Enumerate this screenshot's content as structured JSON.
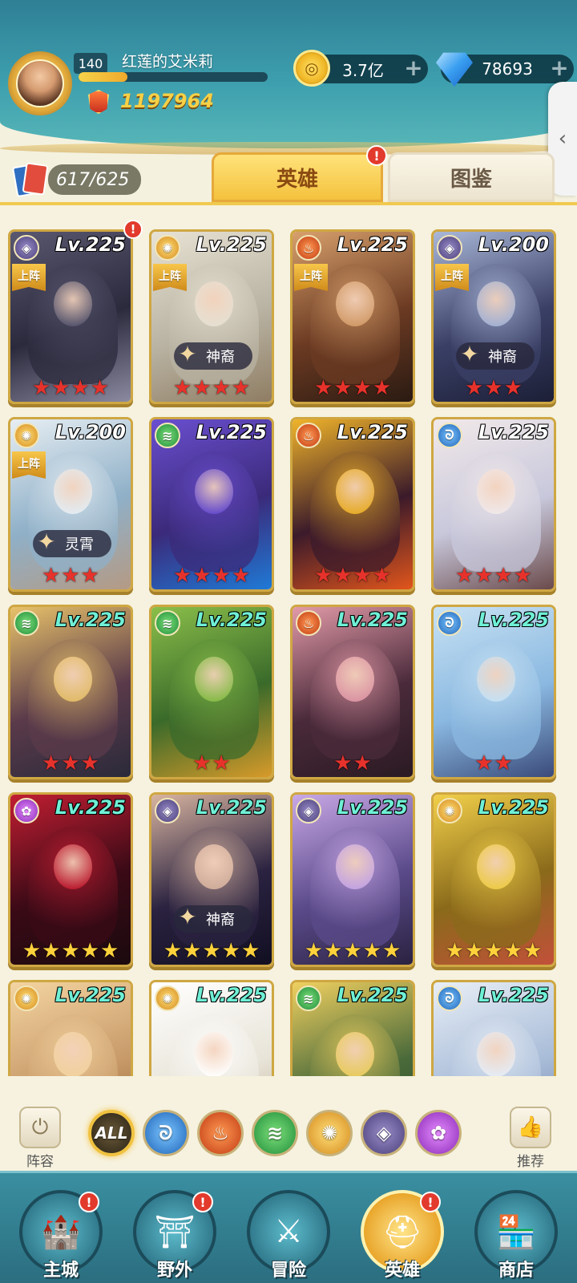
{
  "player": {
    "level": "140",
    "name": "红莲的艾米莉",
    "exp_fraction": 0.26,
    "power": "1197964",
    "avatar_icon": "player-avatar"
  },
  "currencies": {
    "gold": "3.7亿",
    "gold_icon_glyph": "◎",
    "diamonds": "78693",
    "plus": "+"
  },
  "side_tab_arrow": "‹",
  "collection": {
    "count": "617/625"
  },
  "tabs": {
    "heroes": "英雄",
    "codex": "图鉴",
    "badge": "!"
  },
  "element_glyphs": {
    "dark": "◈",
    "light": "✺",
    "fire": "♨",
    "wind": "≋",
    "water": "ᘐ",
    "arcane": "✿"
  },
  "labels": {
    "deployed": "上阵",
    "star": "★",
    "badge": "!"
  },
  "heroes": [
    {
      "element": "dark",
      "level": "Lv.225",
      "deployed": true,
      "tag": "",
      "stars": 4,
      "star_color": "red",
      "badge": true,
      "level_color": "white",
      "palette": [
        "#2b2a3d",
        "#5a5870",
        "#8b8aa0"
      ]
    },
    {
      "element": "light",
      "level": "Lv.225",
      "deployed": true,
      "tag": "神裔",
      "stars": 4,
      "star_color": "red",
      "badge": false,
      "level_color": "white",
      "palette": [
        "#b9b3a3",
        "#e8e2d4",
        "#8f7d63"
      ]
    },
    {
      "element": "fire",
      "level": "Lv.225",
      "deployed": true,
      "tag": "",
      "stars": 4,
      "star_color": "red",
      "badge": false,
      "level_color": "white",
      "palette": [
        "#6b3a22",
        "#d7a06c",
        "#2a1a12"
      ]
    },
    {
      "element": "dark",
      "level": "Lv.200",
      "deployed": true,
      "tag": "神裔",
      "stars": 3,
      "star_color": "red",
      "badge": false,
      "level_color": "white",
      "palette": [
        "#3a3f66",
        "#a9b7d8",
        "#1c1f36"
      ]
    },
    {
      "element": "light",
      "level": "Lv.200",
      "deployed": true,
      "tag": "灵霄",
      "stars": 3,
      "star_color": "red",
      "badge": false,
      "level_color": "white",
      "palette": [
        "#8fb0c8",
        "#e7eef3",
        "#b59a84"
      ]
    },
    {
      "element": "wind",
      "level": "Lv.225",
      "deployed": false,
      "tag": "",
      "stars": 4,
      "star_color": "red",
      "badge": false,
      "level_color": "white",
      "palette": [
        "#3b2a7a",
        "#6a4fd0",
        "#1f7ad6"
      ]
    },
    {
      "element": "fire",
      "level": "Lv.225",
      "deployed": false,
      "tag": "",
      "stars": 4,
      "star_color": "red",
      "badge": false,
      "level_color": "white",
      "palette": [
        "#3b1a2a",
        "#f0b42a",
        "#e2561c"
      ]
    },
    {
      "element": "water",
      "level": "Lv.225",
      "deployed": false,
      "tag": "",
      "stars": 4,
      "star_color": "red",
      "badge": false,
      "level_color": "white",
      "palette": [
        "#c8c8dc",
        "#f2e9e9",
        "#6a4a4a"
      ]
    },
    {
      "element": "wind",
      "level": "Lv.225",
      "deployed": false,
      "tag": "",
      "stars": 3,
      "star_color": "red",
      "badge": false,
      "level_color": "teal",
      "palette": [
        "#5a3a4a",
        "#e8c26a",
        "#2a2a3a"
      ]
    },
    {
      "element": "wind",
      "level": "Lv.225",
      "deployed": false,
      "tag": "",
      "stars": 2,
      "star_color": "red",
      "badge": false,
      "level_color": "teal",
      "palette": [
        "#3a6a2a",
        "#8bbf4a",
        "#d79a2a"
      ]
    },
    {
      "element": "fire",
      "level": "Lv.225",
      "deployed": false,
      "tag": "",
      "stars": 2,
      "star_color": "red",
      "badge": false,
      "level_color": "teal",
      "palette": [
        "#4a2a3a",
        "#e29aa8",
        "#2a1a22"
      ]
    },
    {
      "element": "water",
      "level": "Lv.225",
      "deployed": false,
      "tag": "",
      "stars": 2,
      "star_color": "red",
      "badge": false,
      "level_color": "teal",
      "palette": [
        "#8ab8e0",
        "#c8e2f4",
        "#3a4a7a"
      ]
    },
    {
      "element": "arcane",
      "level": "Lv.225",
      "deployed": false,
      "tag": "",
      "stars": 5,
      "star_color": "gold",
      "badge": false,
      "level_color": "teal",
      "palette": [
        "#3a0a16",
        "#c21e32",
        "#1a0a0e"
      ]
    },
    {
      "element": "dark",
      "level": "Lv.225",
      "deployed": false,
      "tag": "神裔",
      "stars": 5,
      "star_color": "gold",
      "badge": false,
      "level_color": "teal",
      "palette": [
        "#2a2240",
        "#d8b4a0",
        "#120f22"
      ]
    },
    {
      "element": "dark",
      "level": "Lv.225",
      "deployed": false,
      "tag": "",
      "stars": 5,
      "star_color": "gold",
      "badge": false,
      "level_color": "teal",
      "palette": [
        "#5a4a8a",
        "#c9a8e6",
        "#2a2240"
      ]
    },
    {
      "element": "light",
      "level": "Lv.225",
      "deployed": false,
      "tag": "",
      "stars": 5,
      "star_color": "gold",
      "badge": false,
      "level_color": "teal",
      "palette": [
        "#8a6a1a",
        "#f2d04a",
        "#c2503a"
      ]
    },
    {
      "element": "light",
      "level": "Lv.225",
      "deployed": false,
      "tag": "",
      "stars": 0,
      "star_color": "gold",
      "badge": false,
      "level_color": "teal",
      "palette": [
        "#c89a6a",
        "#f3d4a0",
        "#8a5a2a"
      ]
    },
    {
      "element": "light",
      "level": "Lv.225",
      "deployed": false,
      "tag": "",
      "stars": 0,
      "star_color": "gold",
      "badge": false,
      "level_color": "teal",
      "palette": [
        "#e8e4d8",
        "#ffffff",
        "#b7a28a"
      ]
    },
    {
      "element": "wind",
      "level": "Lv.225",
      "deployed": false,
      "tag": "",
      "stars": 0,
      "star_color": "gold",
      "badge": false,
      "level_color": "teal",
      "palette": [
        "#4a6a3a",
        "#f0d060",
        "#2a4a2a"
      ]
    },
    {
      "element": "water",
      "level": "Lv.225",
      "deployed": false,
      "tag": "",
      "stars": 0,
      "star_color": "gold",
      "badge": false,
      "level_color": "teal",
      "palette": [
        "#a8bcd8",
        "#e8eef6",
        "#6a7aa0"
      ]
    }
  ],
  "filters": {
    "left_label": "阵容",
    "right_label": "推荐",
    "all_label": "ALL",
    "items": [
      "all",
      "water",
      "fire",
      "wind",
      "light",
      "dark",
      "arcane"
    ]
  },
  "nav": [
    {
      "label": "主城",
      "icon": "castle-icon",
      "glyph": "🏰",
      "badge": true,
      "active": false
    },
    {
      "label": "野外",
      "icon": "gate-icon",
      "glyph": "⛩",
      "badge": true,
      "active": false
    },
    {
      "label": "冒险",
      "icon": "sword-icon",
      "glyph": "⚔",
      "badge": false,
      "active": false
    },
    {
      "label": "英雄",
      "icon": "knight-helmet-icon",
      "glyph": "⛑",
      "badge": true,
      "active": true
    },
    {
      "label": "商店",
      "icon": "shop-icon",
      "glyph": "🏪",
      "badge": false,
      "active": false
    }
  ]
}
